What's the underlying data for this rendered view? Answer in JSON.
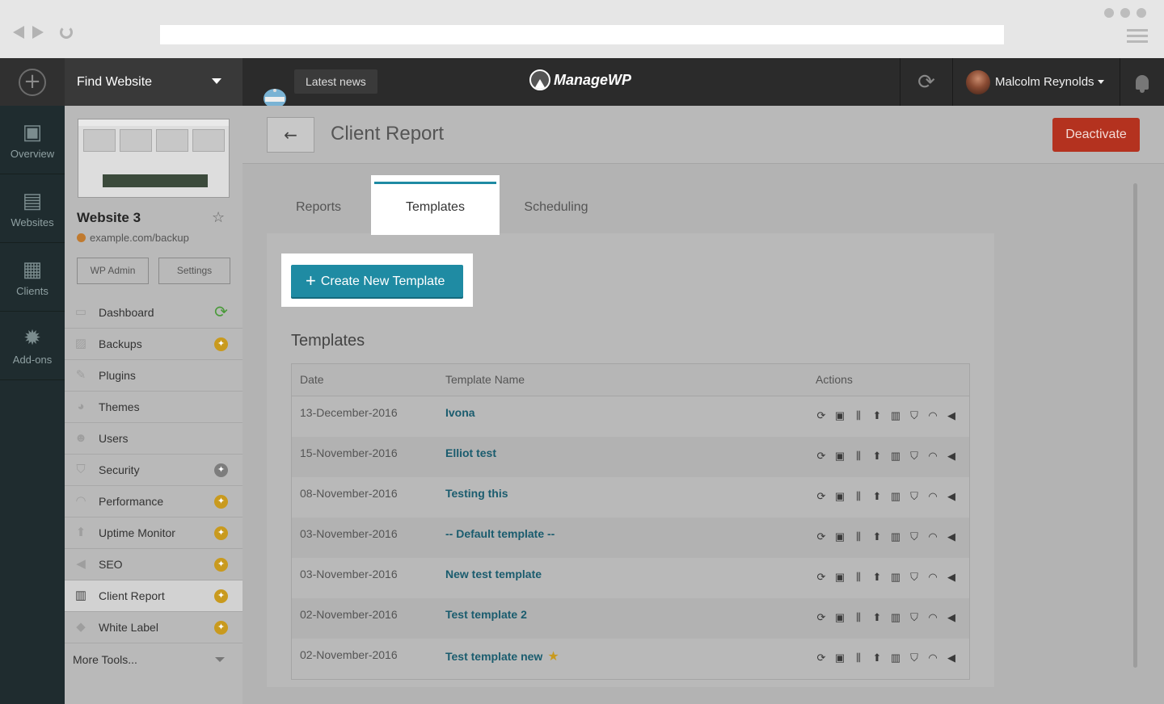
{
  "header": {
    "find_website": "Find Website",
    "latest_news": "Latest news",
    "logo_text": "ManageWP",
    "user_name": "Malcolm Reynolds"
  },
  "leftnav": {
    "items": [
      {
        "label": "Overview",
        "icon": "monitor-chart-icon"
      },
      {
        "label": "Websites",
        "icon": "pages-icon"
      },
      {
        "label": "Clients",
        "icon": "briefcase-icon"
      },
      {
        "label": "Add-ons",
        "icon": "star-badge-icon"
      }
    ]
  },
  "sidebar": {
    "site_name": "Website 3",
    "site_url": "example.com/backup",
    "wp_admin": "WP Admin",
    "settings": "Settings",
    "items": [
      {
        "label": "Dashboard",
        "icon": "monitor-icon",
        "badge": "refresh"
      },
      {
        "label": "Backups",
        "icon": "drive-icon",
        "badge": "gold"
      },
      {
        "label": "Plugins",
        "icon": "plug-icon",
        "badge": ""
      },
      {
        "label": "Themes",
        "icon": "palette-icon",
        "badge": ""
      },
      {
        "label": "Users",
        "icon": "user-icon",
        "badge": ""
      },
      {
        "label": "Security",
        "icon": "shield-icon",
        "badge": "gray"
      },
      {
        "label": "Performance",
        "icon": "gauge-icon",
        "badge": "gold"
      },
      {
        "label": "Uptime Monitor",
        "icon": "arrow-up-icon",
        "badge": "gold"
      },
      {
        "label": "SEO",
        "icon": "megaphone-icon",
        "badge": "gold"
      },
      {
        "label": "Client Report",
        "icon": "chart-icon",
        "badge": "gold"
      },
      {
        "label": "White Label",
        "icon": "tag-icon",
        "badge": "gold"
      }
    ],
    "more_tools": "More Tools..."
  },
  "main": {
    "title": "Client Report",
    "deactivate": "Deactivate",
    "tabs": [
      {
        "label": "Reports"
      },
      {
        "label": "Templates",
        "active": true
      },
      {
        "label": "Scheduling"
      }
    ],
    "create_button": "Create New Template",
    "section_title": "Templates",
    "columns": [
      "Date",
      "Template Name",
      "Actions"
    ],
    "rows": [
      {
        "date": "13-December-2016",
        "name": "Ivona",
        "starred": false
      },
      {
        "date": "15-November-2016",
        "name": "Elliot test",
        "starred": false
      },
      {
        "date": "08-November-2016",
        "name": "Testing this",
        "starred": false
      },
      {
        "date": "03-November-2016",
        "name": "-- Default template --",
        "starred": false
      },
      {
        "date": "03-November-2016",
        "name": "New test template",
        "starred": false
      },
      {
        "date": "02-November-2016",
        "name": "Test template 2",
        "starred": false
      },
      {
        "date": "02-November-2016",
        "name": "Test template new",
        "starred": true
      }
    ]
  },
  "colors": {
    "accent": "#1f8ba3",
    "danger": "#b4321f",
    "badge_gold": "#c99a1e"
  }
}
